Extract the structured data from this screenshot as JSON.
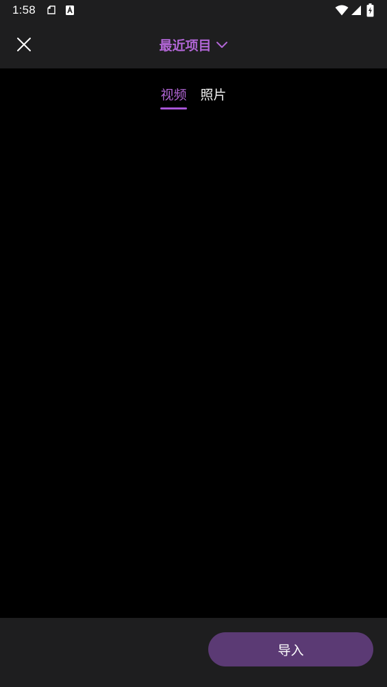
{
  "status_bar": {
    "time": "1:58",
    "icons": [
      "clipboard-icon",
      "a-letter-icon",
      "wifi-icon",
      "signal-icon",
      "battery-charging-icon"
    ]
  },
  "header": {
    "close_icon": "close-icon",
    "album_title": "最近项目",
    "chevron_icon": "chevron-down-icon"
  },
  "tabs": [
    {
      "label": "视频",
      "active": true
    },
    {
      "label": "照片",
      "active": false
    }
  ],
  "footer": {
    "import_label": "导入"
  },
  "colors": {
    "accent": "#b266d6",
    "bar_background": "#1e1e1f",
    "import_button": "#5b3a74"
  }
}
